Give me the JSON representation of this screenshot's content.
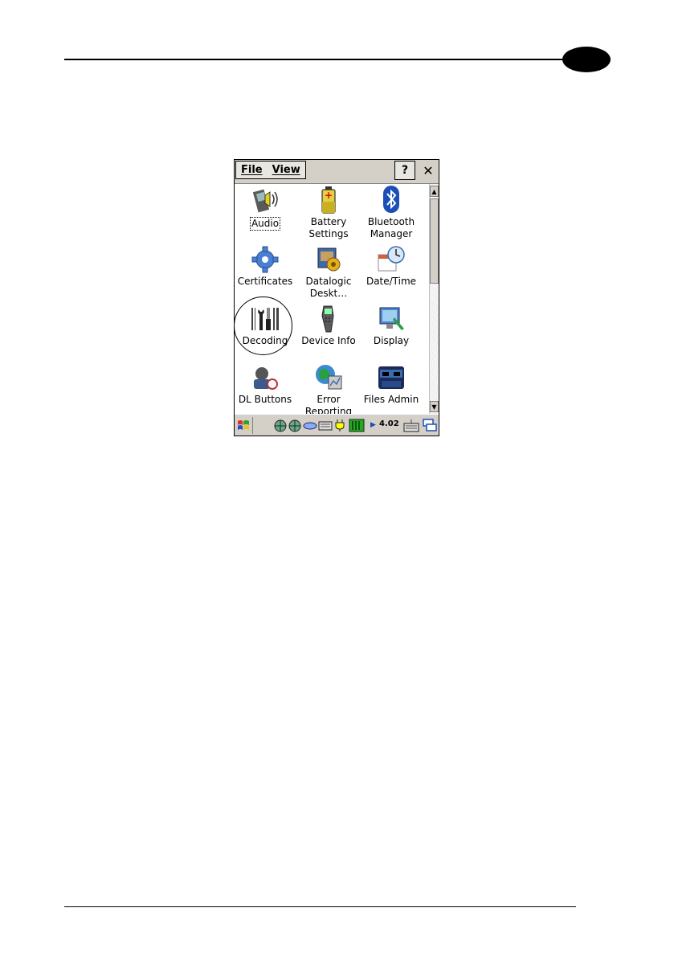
{
  "menubar": {
    "file_label": "File",
    "view_label": "View",
    "help_label": "?",
    "close_label": "✕"
  },
  "control_panel": {
    "items": [
      {
        "label": "Audio",
        "icon": "audio-icon",
        "selected": true
      },
      {
        "label": "Battery\nSettings",
        "icon": "battery-icon"
      },
      {
        "label": "Bluetooth\nManager",
        "icon": "bluetooth-icon"
      },
      {
        "label": "Certificates",
        "icon": "certificates-icon"
      },
      {
        "label": "Datalogic\nDeskt…",
        "icon": "datalogic-desktop-icon"
      },
      {
        "label": "Date/Time",
        "icon": "date-time-icon"
      },
      {
        "label": "Decoding",
        "icon": "decoding-icon"
      },
      {
        "label": "Device Info",
        "icon": "device-info-icon"
      },
      {
        "label": "Display",
        "icon": "display-icon"
      },
      {
        "label": "DL Buttons",
        "icon": "dl-buttons-icon"
      },
      {
        "label": "Error\nReporting",
        "icon": "error-reporting-icon"
      },
      {
        "label": "Files Admin",
        "icon": "files-admin-icon"
      }
    ]
  },
  "taskbar": {
    "version": "4.02"
  },
  "colors": {
    "toolbar_bg": "#d4d0c8",
    "bluetooth_blue": "#1c4fb5",
    "gear_blue": "#4a7fd4"
  }
}
